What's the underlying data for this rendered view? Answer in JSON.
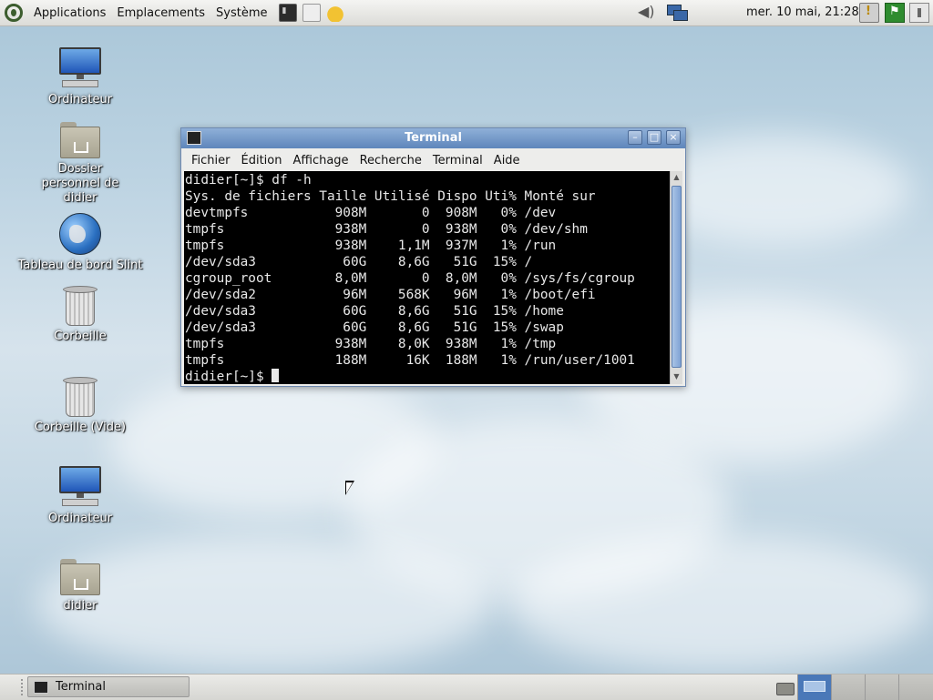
{
  "top_panel": {
    "menus": [
      "Applications",
      "Emplacements",
      "Système"
    ],
    "clock": "mer. 10 mai, 21:28"
  },
  "desktop_icons": [
    {
      "label": "Ordinateur",
      "icon": "computer-icon"
    },
    {
      "label": "Dossier personnel de didier",
      "icon": "home-folder-icon"
    },
    {
      "label": "Tableau de bord Slint",
      "icon": "globe-icon"
    },
    {
      "label": "Corbeille",
      "icon": "trash-icon"
    },
    {
      "label": "Corbeille (Vide)",
      "icon": "trash-icon"
    },
    {
      "label": "Ordinateur",
      "icon": "computer-icon"
    },
    {
      "label": "didier",
      "icon": "home-folder-icon"
    }
  ],
  "terminal": {
    "title": "Terminal",
    "menu": [
      "Fichier",
      "Édition",
      "Affichage",
      "Recherche",
      "Terminal",
      "Aide"
    ],
    "command_line": "didier[~]$ df -h",
    "header": "Sys. de fichiers Taille Utilisé Dispo Uti% Monté sur",
    "rows": [
      "devtmpfs           908M       0  908M   0% /dev",
      "tmpfs              938M       0  938M   0% /dev/shm",
      "tmpfs              938M    1,1M  937M   1% /run",
      "/dev/sda3           60G    8,6G   51G  15% /",
      "cgroup_root        8,0M       0  8,0M   0% /sys/fs/cgroup",
      "/dev/sda2           96M    568K   96M   1% /boot/efi",
      "/dev/sda3           60G    8,6G   51G  15% /home",
      "/dev/sda3           60G    8,6G   51G  15% /swap",
      "tmpfs              938M    8,0K  938M   1% /tmp",
      "tmpfs              188M     16K  188M   1% /run/user/1001"
    ],
    "prompt": "didier[~]$ "
  },
  "taskbar": {
    "task_label": "Terminal"
  },
  "colors": {
    "titlebar": "#5e86bb",
    "terminal_bg": "#000000",
    "terminal_fg": "#e8e8e8"
  }
}
